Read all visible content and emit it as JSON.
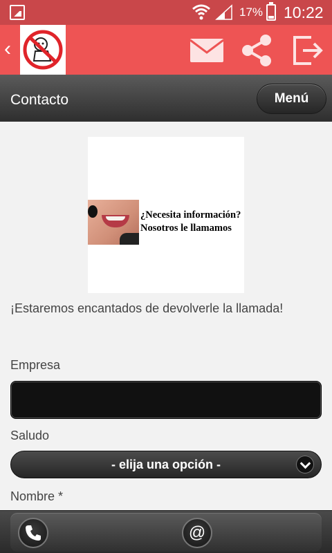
{
  "status_bar": {
    "battery_percent": "17%",
    "time": "10:22"
  },
  "action_bar": {
    "icons": [
      "back-icon",
      "app-logo",
      "mail-icon",
      "share-icon",
      "exit-icon"
    ],
    "accent_color": "#ee5454"
  },
  "header": {
    "title": "Contacto",
    "menu_label": "Menú"
  },
  "banner": {
    "line1": "¿Necesita información?",
    "line2": "Nosotros le llamamos"
  },
  "intro_text": "¡Estaremos encantados de devolverle la llamada!",
  "form": {
    "empresa_label": "Empresa",
    "empresa_value": "",
    "saludo_label": "Saludo",
    "saludo_selected": "- elija una opción -",
    "nombre_label": "Nombre *"
  },
  "bottom_bar": {
    "icons": [
      "phone-icon",
      "at-icon"
    ],
    "at_glyph": "@"
  }
}
